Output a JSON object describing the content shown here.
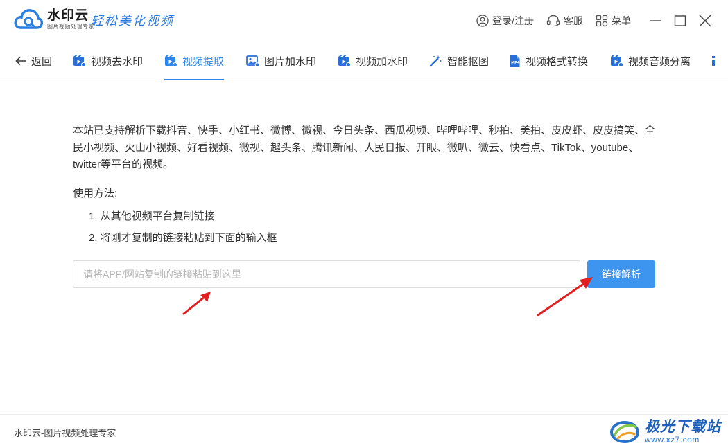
{
  "app": {
    "name": "水印云",
    "subtitle": "图片视频处理专家",
    "slogan": "轻松美化视频"
  },
  "title_actions": {
    "login": "登录/注册",
    "service": "客服",
    "menu": "菜单"
  },
  "nav": {
    "back": "返回",
    "items": [
      {
        "label": "视频去水印",
        "icon": "video-clip-icon"
      },
      {
        "label": "视频提取",
        "icon": "video-extract-icon",
        "active": true
      },
      {
        "label": "图片加水印",
        "icon": "image-icon"
      },
      {
        "label": "视频加水印",
        "icon": "video-watermark-icon"
      },
      {
        "label": "智能抠图",
        "icon": "magic-wand-icon"
      },
      {
        "label": "视频格式转换",
        "icon": "mp4-file-icon"
      },
      {
        "label": "视频音频分离",
        "icon": "video-audio-icon"
      }
    ]
  },
  "main": {
    "intro": "本站已支持解析下载抖音、快手、小红书、微博、微视、今日头条、西瓜视频、哔哩哔哩、秒拍、美拍、皮皮虾、皮皮搞笑、全民小视频、火山小视频、好看视频、微视、趣头条、腾讯新闻、人民日报、开眼、微叭、微云、快看点、TikTok、youtube、twitter等平台的视频。",
    "usage_title": "使用方法:",
    "steps": [
      "1. 从其他视频平台复制链接",
      "2. 将刚才复制的链接粘贴到下面的输入框"
    ],
    "input_placeholder": "请将APP/网站复制的链接粘贴到这里",
    "input_value": "",
    "parse_button": "链接解析"
  },
  "footer": {
    "text": "水印云-图片视频处理专家",
    "watermark_name": "极光下载站",
    "watermark_url": "www.xz7.com"
  },
  "colors": {
    "accent": "#2f86e8",
    "button": "#3d95f0",
    "arrow": "#e02020"
  }
}
